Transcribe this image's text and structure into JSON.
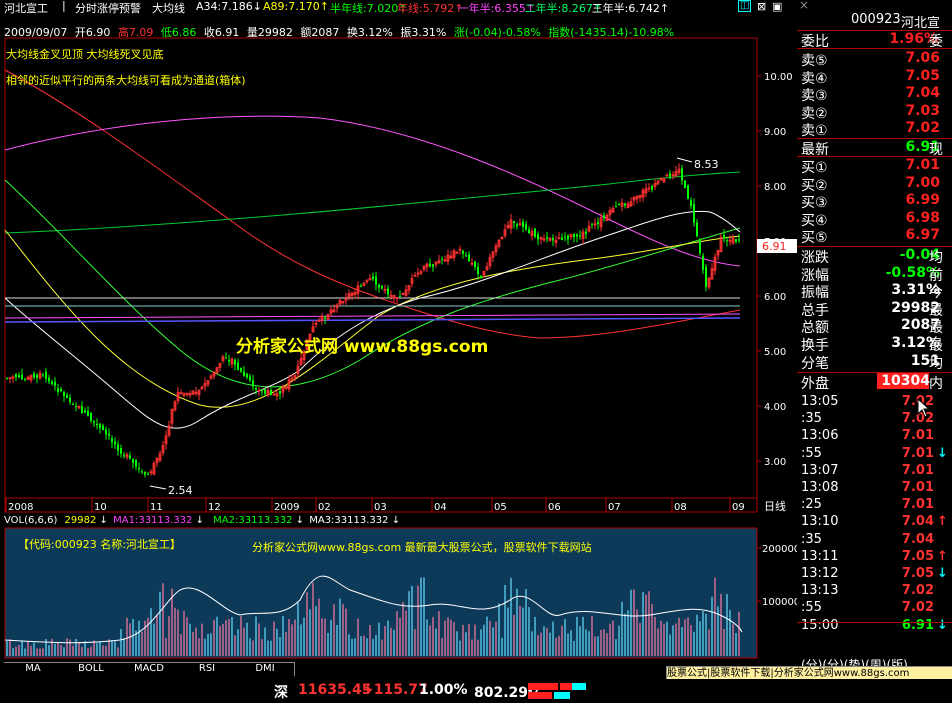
{
  "header": {
    "stock_name": "河北宣工",
    "tabs": [
      "分时涨停预警",
      "大均线"
    ],
    "ma_items": [
      {
        "label": "A34:7.186",
        "arrow": "↓",
        "color": "#ffffff"
      },
      {
        "label": "A89:7.170",
        "arrow": "↑",
        "color": "#ffff00"
      },
      {
        "label": "半年线:7.020",
        "arrow": "↑",
        "color": "#00ff00"
      },
      {
        "label": "年线:5.792",
        "arrow": "↑",
        "color": "#ff3232"
      },
      {
        "label": "一年半:6.355",
        "arrow": "↑",
        "color": "#ff44ff"
      },
      {
        "label": "二年半:8.267",
        "arrow": "↑",
        "color": "#00ff66"
      },
      {
        "label": "三年半:6.742",
        "arrow": "↑",
        "color": "#ffffff"
      }
    ],
    "info_date": "2009/09/07",
    "info_open": "开6.90",
    "info_high": "高7.09",
    "info_low": "低6.86",
    "info_close": "收6.91",
    "info_vol": "量29982",
    "info_amount": "额2087",
    "info_turnover": "换3.12%",
    "info_amp": "振3.31%",
    "info_change": "涨(-0.04)-0.58%",
    "info_index": "指数(-1435.14)-10.98%"
  },
  "annotations": {
    "line1": "大均线金叉见顶   大均线死叉见底",
    "line2": "相邻的近似平行的两条大均线可看成为通道(箱体)",
    "watermark": "分析家公式网 www.88gs.com",
    "high_label": "8.53",
    "low_label": "2.54",
    "price_tag": "6.91"
  },
  "price_axis": [
    "10.00",
    "9.00",
    "8.00",
    "7.00",
    "6.00",
    "5.00",
    "4.00",
    "3.00"
  ],
  "time_axis": [
    "2008",
    "10",
    "11",
    "12",
    "2009",
    "02",
    "03",
    "04",
    "05",
    "06",
    "07",
    "08",
    "09"
  ],
  "period_label": "日线",
  "volume": {
    "header": "VOL(6,6,6)",
    "value": "29982",
    "ma1": "MA1:33113.332",
    "ma2": "MA2:33113.332",
    "ma3": "MA3:33113.332",
    "banner_code": "【代码:000923 名称:河北宣工】",
    "banner_text": "分析家公式网www.88gs.com 最新最大股票公式，股票软件下载网站",
    "axis": [
      "200000",
      "100000"
    ]
  },
  "bottom_tabs": [
    "MA",
    "BOLL",
    "MACD",
    "RSI",
    "DMI"
  ],
  "right_panel": {
    "code": "000923",
    "name": "河北宣",
    "ratio_label": "委比",
    "ratio_value": "1.96%",
    "ratio_suffix": "委",
    "sells": [
      {
        "label": "卖⑤",
        "price": "7.06"
      },
      {
        "label": "卖④",
        "price": "7.05"
      },
      {
        "label": "卖③",
        "price": "7.04"
      },
      {
        "label": "卖②",
        "price": "7.03"
      },
      {
        "label": "卖①",
        "price": "7.02"
      }
    ],
    "last_label": "最新",
    "last_value": "6.91",
    "last_suffix": "现",
    "buys": [
      {
        "label": "买①",
        "price": "7.01"
      },
      {
        "label": "买②",
        "price": "7.00"
      },
      {
        "label": "买③",
        "price": "6.99"
      },
      {
        "label": "买④",
        "price": "6.98"
      },
      {
        "label": "买⑤",
        "price": "6.97"
      }
    ],
    "stats": [
      {
        "label": "涨跌",
        "value": "-0.04",
        "suffix": "均",
        "color": "#00ff00"
      },
      {
        "label": "涨幅",
        "value": "-0.58%",
        "suffix": "前",
        "color": "#00ff00"
      },
      {
        "label": "振幅",
        "value": "3.31%",
        "suffix": "今",
        "color": "#ffffff"
      },
      {
        "label": "总手",
        "value": "29982",
        "suffix": "最",
        "color": "#ffffff"
      },
      {
        "label": "总额",
        "value": "2087",
        "suffix": "最",
        "color": "#ffffff"
      },
      {
        "label": "换手",
        "value": "3.12%",
        "suffix": "最",
        "color": "#ffffff"
      },
      {
        "label": "分笔",
        "value": "151",
        "suffix": "均",
        "color": "#ffffff"
      }
    ],
    "outer_label": "外盘",
    "outer_value": "10304",
    "outer_suffix": "内",
    "ticks": [
      {
        "time": "13:05",
        "price": "7.02",
        "arrow": "",
        "arrow_color": ""
      },
      {
        "time": ":35",
        "price": "7.02",
        "arrow": "",
        "arrow_color": ""
      },
      {
        "time": "13:06",
        "price": "7.01",
        "arrow": "",
        "arrow_color": ""
      },
      {
        "time": ":55",
        "price": "7.01",
        "arrow": "↓",
        "arrow_color": "#00ffff"
      },
      {
        "time": "13:07",
        "price": "7.01",
        "arrow": "",
        "arrow_color": ""
      },
      {
        "time": "13:08",
        "price": "7.01",
        "arrow": "",
        "arrow_color": ""
      },
      {
        "time": ":25",
        "price": "7.01",
        "arrow": "",
        "arrow_color": ""
      },
      {
        "time": "13:10",
        "price": "7.04",
        "arrow": "↑",
        "arrow_color": "#ff3232"
      },
      {
        "time": ":35",
        "price": "7.04",
        "arrow": "",
        "arrow_color": ""
      },
      {
        "time": "13:11",
        "price": "7.05",
        "arrow": "↑",
        "arrow_color": "#ff3232"
      },
      {
        "time": "13:12",
        "price": "7.05",
        "arrow": "↓",
        "arrow_color": "#00ffff"
      },
      {
        "time": "13:13",
        "price": "7.02",
        "arrow": "",
        "arrow_color": ""
      },
      {
        "time": ":55",
        "price": "7.02",
        "arrow": "",
        "arrow_color": ""
      },
      {
        "time": "15:00",
        "price": "6.91",
        "arrow": "↓",
        "arrow_color": "#00ffff"
      }
    ],
    "footer_partial": "(分)(分)(势)(周)(版)"
  },
  "ad_banner": "股票公式|股票软件下载|分析家公式网www.88gs.com",
  "status": {
    "market": "深",
    "index": "11635.45",
    "change": "+115.77",
    "pct": "1.00%",
    "amount": "802.29亿"
  },
  "colors": {
    "up": "#ff3232",
    "down": "#00ff00",
    "text_yellow": "#ffff00",
    "panel_red": "#ff2020",
    "banner_bg": "#103050"
  }
}
